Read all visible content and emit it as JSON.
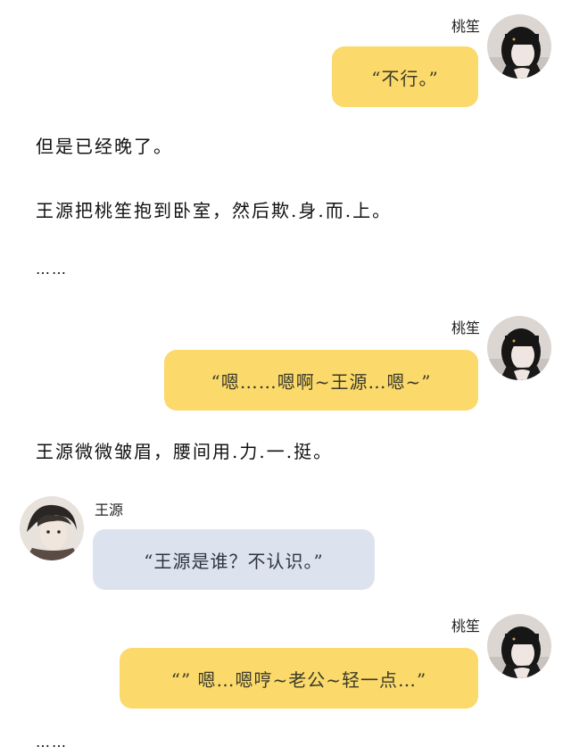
{
  "messages": [
    {
      "speaker": "桃笙",
      "text": "“不行。”"
    },
    {
      "speaker": "桃笙",
      "text": "“嗯……嗯啊~王源…嗯~”"
    },
    {
      "speaker": "王源",
      "text": "“王源是谁？不认识。”"
    },
    {
      "speaker": "桃笙",
      "text": "“” 嗯…嗯哼~老公~轻一点…”"
    }
  ],
  "narration": [
    "但是已经晚了。",
    "王源把桃笙抱到卧室，然后欺.身.而.上。",
    "……",
    "王源微微皱眉，腰间用.力.一.挺。",
    "……"
  ],
  "colors": {
    "own_bubble": "#fbd96a",
    "other_bubble": "#dde3ee"
  }
}
